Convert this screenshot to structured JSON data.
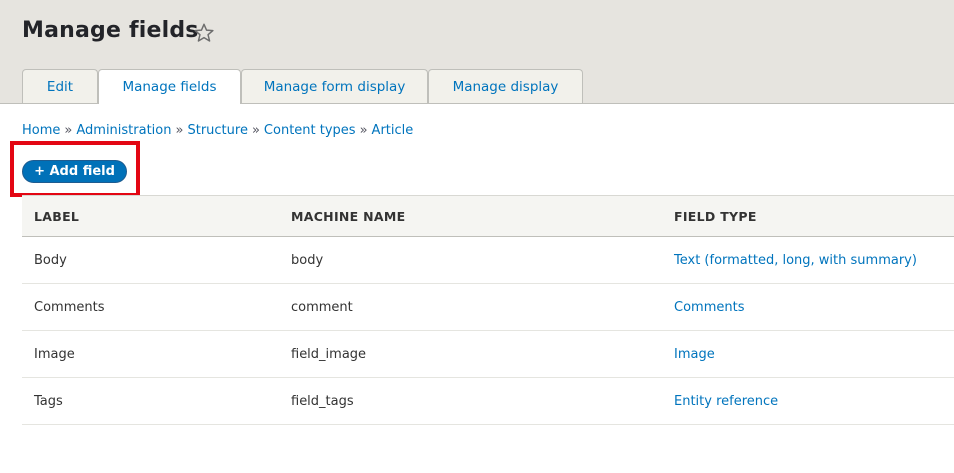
{
  "page": {
    "title": "Manage fields"
  },
  "tabs": [
    {
      "label": "Edit",
      "active": false
    },
    {
      "label": "Manage fields",
      "active": true
    },
    {
      "label": "Manage form display",
      "active": false
    },
    {
      "label": "Manage display",
      "active": false
    }
  ],
  "breadcrumb": [
    {
      "label": "Home"
    },
    {
      "label": "Administration"
    },
    {
      "label": "Structure"
    },
    {
      "label": "Content types"
    },
    {
      "label": "Article"
    }
  ],
  "breadcrumb_separator": "»",
  "actions": {
    "add_field_label": "+ Add field"
  },
  "table": {
    "headers": [
      "LABEL",
      "MACHINE NAME",
      "FIELD TYPE"
    ],
    "rows": [
      {
        "label": "Body",
        "machine_name": "body",
        "field_type": "Text (formatted, long, with summary)"
      },
      {
        "label": "Comments",
        "machine_name": "comment",
        "field_type": "Comments"
      },
      {
        "label": "Image",
        "machine_name": "field_image",
        "field_type": "Image"
      },
      {
        "label": "Tags",
        "machine_name": "field_tags",
        "field_type": "Entity reference"
      }
    ]
  },
  "colors": {
    "link": "#0074bd",
    "primary_button": "#0071b8",
    "highlight": "#e30613",
    "header_bg": "#e6e4df"
  },
  "icons": {
    "favorite": "star-icon"
  }
}
